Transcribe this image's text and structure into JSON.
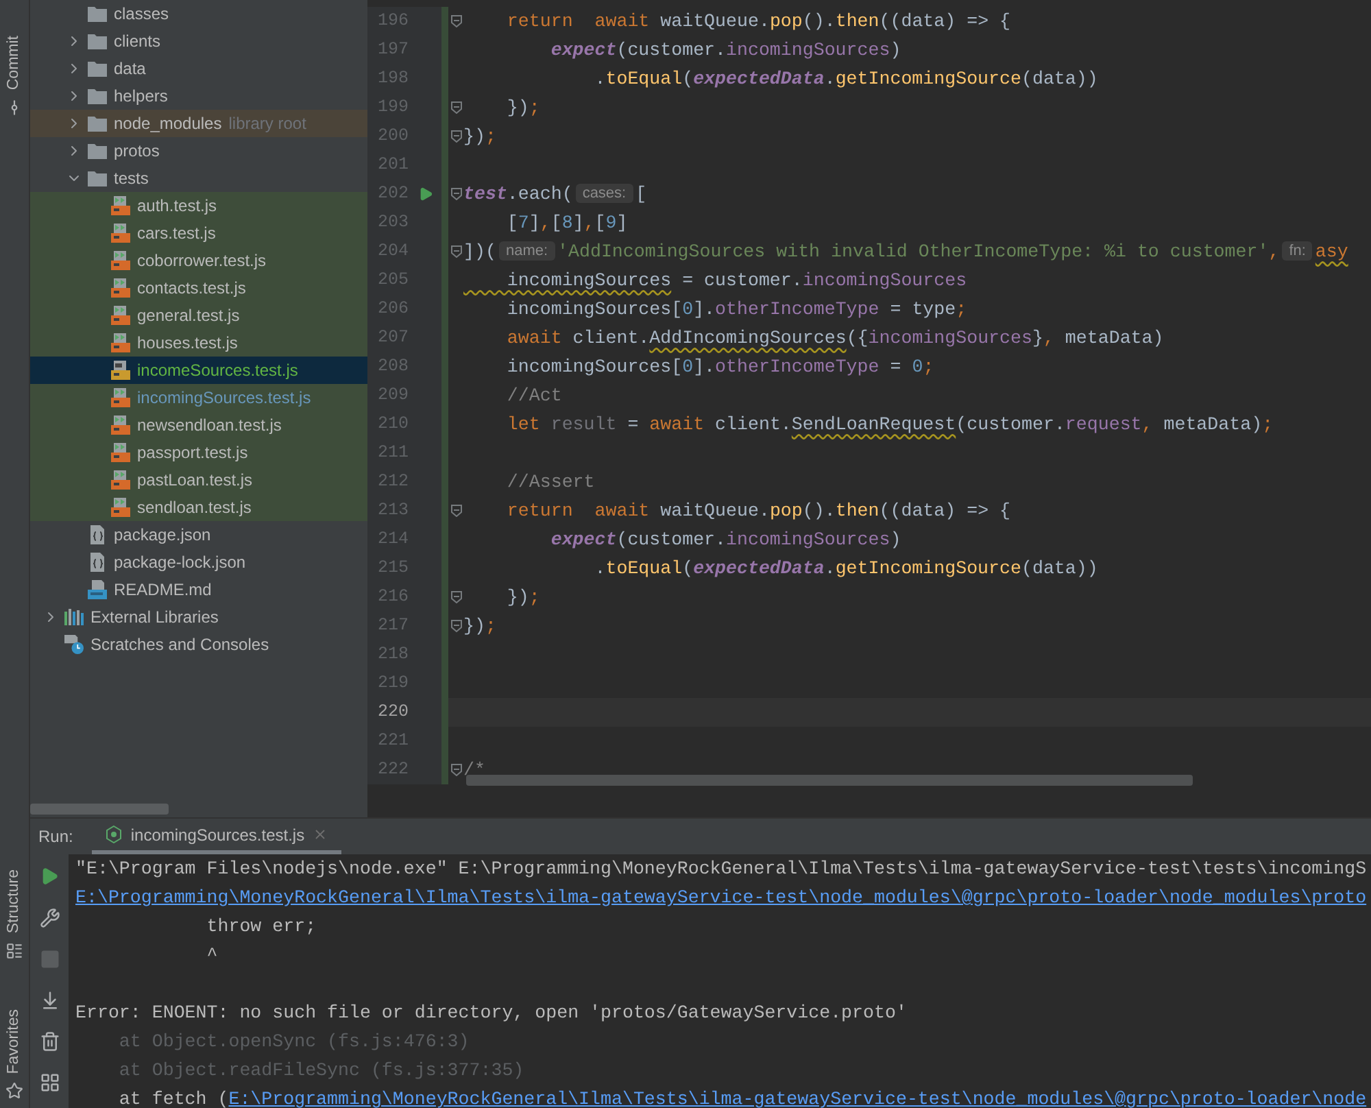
{
  "tool_strip": {
    "top": [
      {
        "label": "Commit",
        "kind": "commit"
      }
    ],
    "bottom": [
      {
        "label": "Structure",
        "kind": "structure"
      },
      {
        "label": "Favorites",
        "kind": "favorites"
      }
    ]
  },
  "project_tree": {
    "items": [
      {
        "label": "classes",
        "kind": "folder",
        "selected": false
      },
      {
        "label": "clients",
        "kind": "folder",
        "expanded": false,
        "selected": false
      },
      {
        "label": "data",
        "kind": "folder",
        "expanded": false,
        "selected": false
      },
      {
        "label": "helpers",
        "kind": "folder",
        "expanded": false,
        "selected": false
      },
      {
        "label": "node_modules",
        "kind": "folder",
        "expanded": false,
        "selected": false,
        "annotation": "library root",
        "library_root": true
      },
      {
        "label": "protos",
        "kind": "folder",
        "expanded": false,
        "selected": false
      },
      {
        "label": "tests",
        "kind": "folder",
        "expanded": true,
        "selected": false,
        "children": [
          {
            "label": "auth.test.js",
            "kind": "test-js",
            "selected": false,
            "test_scope": true
          },
          {
            "label": "cars.test.js",
            "kind": "test-js",
            "selected": false,
            "test_scope": true
          },
          {
            "label": "coborrower.test.js",
            "kind": "test-js",
            "selected": false,
            "test_scope": true
          },
          {
            "label": "contacts.test.js",
            "kind": "test-js",
            "selected": false,
            "test_scope": true
          },
          {
            "label": "general.test.js",
            "kind": "test-js",
            "selected": false,
            "test_scope": true
          },
          {
            "label": "houses.test.js",
            "kind": "test-js",
            "selected": false,
            "test_scope": true
          },
          {
            "label": "incomeSources.test.js",
            "kind": "js",
            "selected": true,
            "test_scope": true,
            "added": true
          },
          {
            "label": "incomingSources.test.js",
            "kind": "test-js",
            "selected": false,
            "test_scope": true,
            "modified": true
          },
          {
            "label": "newsendloan.test.js",
            "kind": "test-js",
            "selected": false,
            "test_scope": true
          },
          {
            "label": "passport.test.js",
            "kind": "test-js",
            "selected": false,
            "test_scope": true
          },
          {
            "label": "pastLoan.test.js",
            "kind": "test-js",
            "selected": false,
            "test_scope": true
          },
          {
            "label": "sendloan.test.js",
            "kind": "test-js",
            "selected": false,
            "test_scope": true
          }
        ]
      },
      {
        "label": "package.json",
        "kind": "json",
        "selected": false
      },
      {
        "label": "package-lock.json",
        "kind": "json",
        "selected": false
      },
      {
        "label": "README.md",
        "kind": "md",
        "selected": false
      }
    ],
    "root_items": [
      {
        "label": "External Libraries",
        "kind": "libraries",
        "expanded": false,
        "selected": false
      },
      {
        "label": "Scratches and Consoles",
        "kind": "scratches",
        "selected": false
      }
    ]
  },
  "editor": {
    "lines": [
      {
        "number": "196",
        "fold": true,
        "changed": true,
        "tokens": [
          {
            "text": "    return",
            "kind": "kw"
          },
          {
            "text": "  await",
            "kind": "kw"
          },
          {
            "text": " waitQueue.",
            "kind": "plain"
          },
          {
            "text": "pop",
            "kind": "fn"
          },
          {
            "text": "().",
            "kind": "plain"
          },
          {
            "text": "then",
            "kind": "fn"
          },
          {
            "text": "((data) => {",
            "kind": "plain"
          }
        ]
      },
      {
        "number": "197",
        "changed": true,
        "tokens": [
          {
            "text": "        expect",
            "kind": "global"
          },
          {
            "text": "(customer.",
            "kind": "plain"
          },
          {
            "text": "incomingSources",
            "kind": "prop"
          },
          {
            "text": ")",
            "kind": "plain"
          }
        ]
      },
      {
        "number": "198",
        "changed": true,
        "tokens": [
          {
            "text": "            .",
            "kind": "plain"
          },
          {
            "text": "toEqual",
            "kind": "fn"
          },
          {
            "text": "(",
            "kind": "plain"
          },
          {
            "text": "expectedData",
            "kind": "global"
          },
          {
            "text": ".",
            "kind": "plain"
          },
          {
            "text": "getIncomingSource",
            "kind": "fn"
          },
          {
            "text": "(data))",
            "kind": "plain"
          }
        ]
      },
      {
        "number": "199",
        "fold": true,
        "changed": true,
        "tokens": [
          {
            "text": "    })",
            "kind": "plain"
          },
          {
            "text": ";",
            "kind": "kw"
          }
        ]
      },
      {
        "number": "200",
        "fold": true,
        "changed": true,
        "tokens": [
          {
            "text": "})",
            "kind": "plain"
          },
          {
            "text": ";",
            "kind": "kw"
          }
        ]
      },
      {
        "number": "201",
        "changed": true
      },
      {
        "number": "202",
        "fold": true,
        "runnable": true,
        "changed": true,
        "tokens": [
          {
            "text": "test",
            "kind": "global"
          },
          {
            "text": ".each(",
            "kind": "plain"
          },
          {
            "text": "cases:",
            "kind": "hint"
          },
          {
            "text": "[",
            "kind": "plain"
          }
        ]
      },
      {
        "number": "203",
        "changed": true,
        "tokens": [
          {
            "text": "    [",
            "kind": "plain"
          },
          {
            "text": "7",
            "kind": "num"
          },
          {
            "text": "]",
            "kind": "plain"
          },
          {
            "text": ",",
            "kind": "kw"
          },
          {
            "text": "[",
            "kind": "plain"
          },
          {
            "text": "8",
            "kind": "num"
          },
          {
            "text": "]",
            "kind": "plain"
          },
          {
            "text": ",",
            "kind": "kw"
          },
          {
            "text": "[",
            "kind": "plain"
          },
          {
            "text": "9",
            "kind": "num"
          },
          {
            "text": "]",
            "kind": "plain"
          }
        ]
      },
      {
        "number": "204",
        "fold": true,
        "changed": true,
        "tokens": [
          {
            "text": "])(",
            "kind": "plain"
          },
          {
            "text": "name:",
            "kind": "hint"
          },
          {
            "text": "'AddIncomingSources with invalid OtherIncomeType: %i to customer'",
            "kind": "str"
          },
          {
            "text": ",",
            "kind": "kw"
          },
          {
            "text": "fn:",
            "kind": "hint"
          },
          {
            "text": "asy",
            "kind": "kw",
            "warn": true
          }
        ]
      },
      {
        "number": "205",
        "changed": true,
        "tokens": [
          {
            "text": "    incomingSources",
            "kind": "plain",
            "warn": true
          },
          {
            "text": " = customer.",
            "kind": "plain"
          },
          {
            "text": "incomingSources",
            "kind": "prop"
          }
        ]
      },
      {
        "number": "206",
        "changed": true,
        "tokens": [
          {
            "text": "    incomingSources[",
            "kind": "plain"
          },
          {
            "text": "0",
            "kind": "num"
          },
          {
            "text": "].",
            "kind": "plain"
          },
          {
            "text": "otherIncomeType",
            "kind": "prop"
          },
          {
            "text": " = type",
            "kind": "plain"
          },
          {
            "text": ";",
            "kind": "kw"
          }
        ]
      },
      {
        "number": "207",
        "changed": true,
        "tokens": [
          {
            "text": "    await",
            "kind": "kw"
          },
          {
            "text": " client.",
            "kind": "plain"
          },
          {
            "text": "AddIncomingSources",
            "kind": "plain",
            "warn": true
          },
          {
            "text": "({",
            "kind": "plain"
          },
          {
            "text": "incomingSources",
            "kind": "prop"
          },
          {
            "text": "}",
            "kind": "plain"
          },
          {
            "text": ",",
            "kind": "kw"
          },
          {
            "text": " metaData)",
            "kind": "plain"
          }
        ]
      },
      {
        "number": "208",
        "changed": true,
        "tokens": [
          {
            "text": "    incomingSources[",
            "kind": "plain"
          },
          {
            "text": "0",
            "kind": "num"
          },
          {
            "text": "].",
            "kind": "plain"
          },
          {
            "text": "otherIncomeType",
            "kind": "prop"
          },
          {
            "text": " = ",
            "kind": "plain"
          },
          {
            "text": "0",
            "kind": "num"
          },
          {
            "text": ";",
            "kind": "kw"
          }
        ]
      },
      {
        "number": "209",
        "changed": true,
        "tokens": [
          {
            "text": "    //Act",
            "kind": "comment"
          }
        ]
      },
      {
        "number": "210",
        "changed": true,
        "tokens": [
          {
            "text": "    let",
            "kind": "kw"
          },
          {
            "text": " result",
            "kind": "unused"
          },
          {
            "text": " = ",
            "kind": "plain"
          },
          {
            "text": "await",
            "kind": "kw"
          },
          {
            "text": " client.",
            "kind": "plain"
          },
          {
            "text": "SendLoanRequest",
            "kind": "plain",
            "warn": true
          },
          {
            "text": "(customer.",
            "kind": "plain"
          },
          {
            "text": "request",
            "kind": "prop"
          },
          {
            "text": ",",
            "kind": "kw"
          },
          {
            "text": " metaData)",
            "kind": "plain"
          },
          {
            "text": ";",
            "kind": "kw"
          }
        ]
      },
      {
        "number": "211",
        "changed": true
      },
      {
        "number": "212",
        "changed": true,
        "tokens": [
          {
            "text": "    //Assert",
            "kind": "comment"
          }
        ]
      },
      {
        "number": "213",
        "fold": true,
        "changed": true,
        "tokens": [
          {
            "text": "    return",
            "kind": "kw"
          },
          {
            "text": "  await",
            "kind": "kw"
          },
          {
            "text": " waitQueue.",
            "kind": "plain"
          },
          {
            "text": "pop",
            "kind": "fn"
          },
          {
            "text": "().",
            "kind": "plain"
          },
          {
            "text": "then",
            "kind": "fn"
          },
          {
            "text": "((data) => {",
            "kind": "plain"
          }
        ]
      },
      {
        "number": "214",
        "changed": true,
        "tokens": [
          {
            "text": "        expect",
            "kind": "global"
          },
          {
            "text": "(customer.",
            "kind": "plain"
          },
          {
            "text": "incomingSources",
            "kind": "prop"
          },
          {
            "text": ")",
            "kind": "plain"
          }
        ]
      },
      {
        "number": "215",
        "changed": true,
        "tokens": [
          {
            "text": "            .",
            "kind": "plain"
          },
          {
            "text": "toEqual",
            "kind": "fn"
          },
          {
            "text": "(",
            "kind": "plain"
          },
          {
            "text": "expectedData",
            "kind": "global"
          },
          {
            "text": ".",
            "kind": "plain"
          },
          {
            "text": "getIncomingSource",
            "kind": "fn"
          },
          {
            "text": "(data))",
            "kind": "plain"
          }
        ]
      },
      {
        "number": "216",
        "fold": true,
        "changed": true,
        "tokens": [
          {
            "text": "    })",
            "kind": "plain"
          },
          {
            "text": ";",
            "kind": "kw"
          }
        ]
      },
      {
        "number": "217",
        "fold": true,
        "changed": true,
        "tokens": [
          {
            "text": "})",
            "kind": "plain"
          },
          {
            "text": ";",
            "kind": "kw"
          }
        ]
      },
      {
        "number": "218",
        "changed": true
      },
      {
        "number": "219",
        "changed": true
      },
      {
        "number": "220",
        "changed": true,
        "current": true
      },
      {
        "number": "221",
        "changed": true
      },
      {
        "number": "222",
        "fold": true,
        "changed": true,
        "tokens": [
          {
            "text": "/*",
            "kind": "comment"
          }
        ]
      }
    ]
  },
  "run_panel": {
    "title": "Run:",
    "tabs": [
      {
        "label": "incomingSources.test.js",
        "selected": true
      }
    ],
    "toolbar": [
      {
        "kind": "rerun",
        "disabled": false
      },
      {
        "kind": "settings",
        "disabled": false
      },
      {
        "kind": "stop",
        "disabled": true
      },
      {
        "kind": "scroll-end",
        "disabled": false
      },
      {
        "kind": "trash",
        "disabled": false
      },
      {
        "kind": "layout",
        "disabled": false
      }
    ],
    "console": [
      {
        "segments": [
          {
            "text": "\"E:\\Program Files\\nodejs\\node.exe\" E:\\Programming\\MoneyRockGeneral\\Ilma\\Tests\\ilma-gatewayService-test\\tests\\incomingS",
            "kind": "plain"
          }
        ]
      },
      {
        "segments": [
          {
            "text": "E:\\Programming\\MoneyRockGeneral\\Ilma\\Tests\\ilma-gatewayService-test\\node_modules\\@grpc\\proto-loader\\node_modules\\proto",
            "kind": "link"
          }
        ]
      },
      {
        "segments": [
          {
            "text": "            throw err;",
            "kind": "plain"
          }
        ]
      },
      {
        "segments": [
          {
            "text": "            ^",
            "kind": "plain"
          }
        ]
      },
      {
        "blank_before": true,
        "segments": [
          {
            "text": "Error: ENOENT: no such file or directory, open 'protos/GatewayService.proto'",
            "kind": "plain"
          }
        ]
      },
      {
        "segments": [
          {
            "text": "    at Object.openSync (fs.js:476:3)",
            "kind": "dim"
          }
        ]
      },
      {
        "segments": [
          {
            "text": "    at Object.readFileSync (fs.js:377:35)",
            "kind": "dim"
          }
        ]
      },
      {
        "segments": [
          {
            "text": "    at fetch (",
            "kind": "plain"
          },
          {
            "text": "E:\\Programming\\MoneyRockGeneral\\Ilma\\Tests\\ilma-gatewayService-test\\node_modules\\@grpc\\proto-loader\\node",
            "kind": "link"
          }
        ]
      }
    ]
  }
}
